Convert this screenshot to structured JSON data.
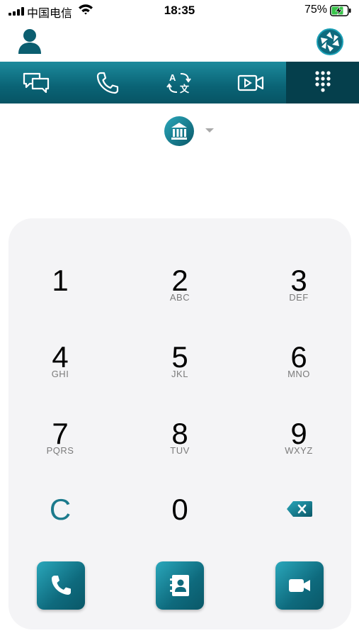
{
  "status_bar": {
    "carrier": "中国电信",
    "time": "18:35",
    "battery": "75%"
  },
  "tabs": [
    {
      "icon": "chat-icon",
      "active": false
    },
    {
      "icon": "phone-icon",
      "active": false
    },
    {
      "icon": "translate-icon",
      "active": false
    },
    {
      "icon": "video-icon",
      "active": false
    },
    {
      "icon": "dialpad-icon",
      "active": true
    }
  ],
  "account_selector": {
    "icon": "bank-icon"
  },
  "keypad": {
    "keys": [
      {
        "digit": "1",
        "letters": ""
      },
      {
        "digit": "2",
        "letters": "ABC"
      },
      {
        "digit": "3",
        "letters": "DEF"
      },
      {
        "digit": "4",
        "letters": "GHI"
      },
      {
        "digit": "5",
        "letters": "JKL"
      },
      {
        "digit": "6",
        "letters": "MNO"
      },
      {
        "digit": "7",
        "letters": "PQRS"
      },
      {
        "digit": "8",
        "letters": "TUV"
      },
      {
        "digit": "9",
        "letters": "WXYZ"
      }
    ],
    "clear": "C",
    "zero": "0"
  },
  "colors": {
    "accent": "#0e6a7d",
    "tab_bar": "#0a6375",
    "tab_active": "#053f4c",
    "keypad_bg": "#f4f4f6"
  }
}
